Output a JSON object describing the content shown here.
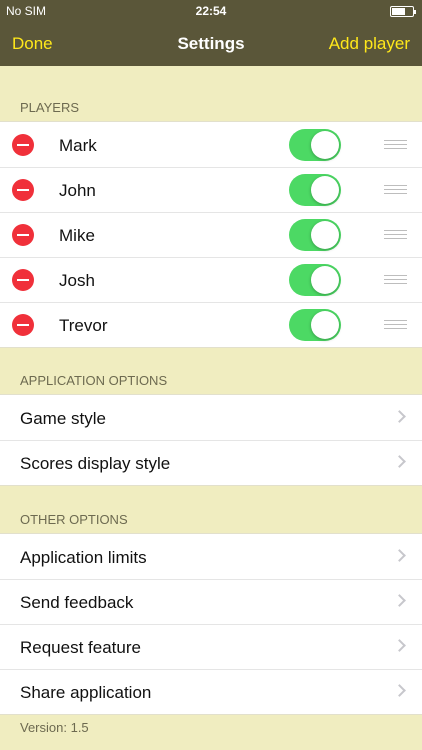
{
  "status_bar": {
    "carrier": "No SIM",
    "time": "22:54"
  },
  "nav": {
    "left_label": "Done",
    "title": "Settings",
    "right_label": "Add player"
  },
  "players": {
    "header": "PLAYERS",
    "items": [
      {
        "name": "Mark",
        "enabled": true
      },
      {
        "name": "John",
        "enabled": true
      },
      {
        "name": "Mike",
        "enabled": true
      },
      {
        "name": "Josh",
        "enabled": true
      },
      {
        "name": "Trevor",
        "enabled": true
      }
    ]
  },
  "application_options": {
    "header": "APPLICATION OPTIONS",
    "items": [
      "Game style",
      "Scores display style"
    ]
  },
  "other_options": {
    "header": "OTHER OPTIONS",
    "items": [
      "Application limits",
      "Send feedback",
      "Request feature",
      "Share application"
    ]
  },
  "footer": {
    "version": "Version: 1.5"
  },
  "colors": {
    "nav_bg": "#5a5639",
    "nav_accent": "#ffe81a",
    "page_bg": "#f0edc0",
    "toggle_on": "#4cd964",
    "delete": "#f0303a"
  }
}
